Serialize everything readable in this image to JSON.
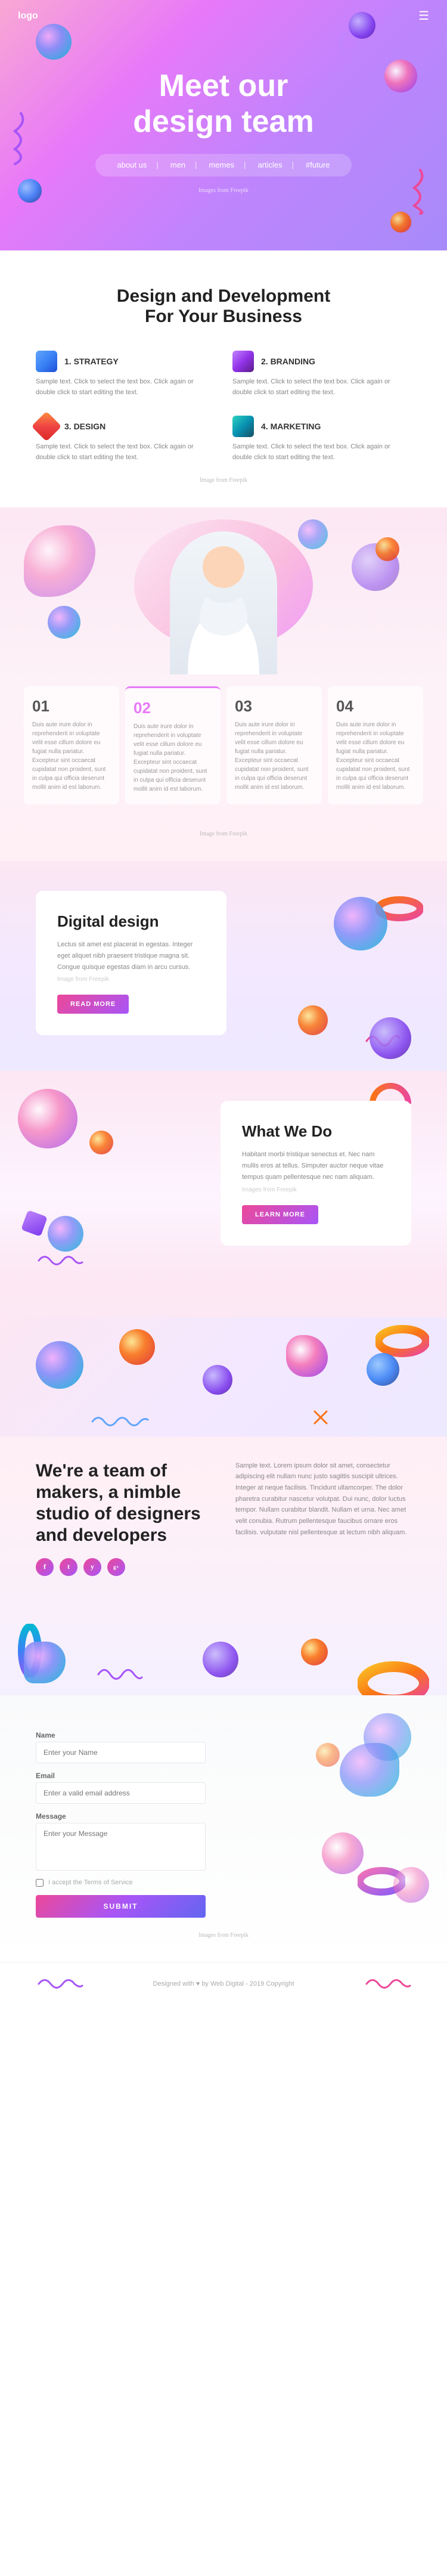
{
  "navbar": {
    "logo": "logo",
    "hamburger": "☰"
  },
  "hero": {
    "title_line1": "Meet our",
    "title_line2": "design team",
    "nav_items": [
      "about us",
      "men",
      "memes",
      "articles",
      "#future"
    ],
    "image_credit": "Images from Freepik"
  },
  "section_design": {
    "title_line1": "Design and Development",
    "title_line2": "For Your Business",
    "cards": [
      {
        "number": "1. STRATEGY",
        "text": "Sample text. Click to select the text box. Click again or double click to start editing the text."
      },
      {
        "number": "2. BRANDING",
        "text": "Sample text. Click to select the text box. Click again or double click to start editing the text."
      },
      {
        "number": "3. DESIGN",
        "text": "Sample text. Click to select the text box. Click again or double click to start editing the text."
      },
      {
        "number": "4. MARKETING",
        "text": "Sample text. Click to select the text box. Click again or double click to start editing the text."
      }
    ],
    "image_credit": "Image from Freepik"
  },
  "section_team": {
    "numbers": [
      {
        "num": "01",
        "text": "Duis aute irure dolor in reprehenderit in voluptate velit esse cillum dolore eu fugiat nulla pariatur. Excepteur sint occaecat cupidatat non proident, sunt in culpa qui officia deserunt mollit anim id est laborum."
      },
      {
        "num": "02",
        "text": "Duis aute irure dolor in reprehenderit in voluptate velit esse cillum dolore eu fugiat nulla pariatur. Excepteur sint occaecat cupidatat non proident, sunt in culpa qui officia deserunt mollit anim id est laborum."
      },
      {
        "num": "03",
        "text": "Duis aute irure dolor in reprehenderit in voluptate velit esse cillum dolore eu fugiat nulla pariatur. Excepteur sint occaecat cupidatat non proident, sunt in culpa qui officia deserunt mollit anim id est laborum."
      },
      {
        "num": "04",
        "text": "Duis aute irure dolor in reprehenderit in voluptate velit esse cillum dolore eu fugiat nulla pariatur. Excepteur sint occaecat cupidatat non proident, sunt in culpa qui officia deserunt mollit anim id est laborum."
      }
    ],
    "image_credit": "Image from Freepik"
  },
  "section_digital": {
    "title": "Digital design",
    "text": "Lectus sit amet est placerat in egestas. Integer eget aliquet nibh praesent tristique magna sit. Congue quisque egestas diam in arcu cursus.",
    "image_credit": "Image from Freepik",
    "button": "READ MORE"
  },
  "section_what": {
    "title": "What We Do",
    "text": "Habitant morbi tristique senectus et. Nec nam mullis eros at tellus. Simputer auctor neque vitae tempus quam pellentesque nec nam aliquam.",
    "image_credit": "Images from Freepik",
    "button": "LEARN MORE"
  },
  "section_makers": {
    "title": "We're a team of makers, a nimble studio of designers and developers",
    "text": "Sample text. Lorem ipsum dolor sit amet, consectetur adipiscing elit nullam nunc justo sagittis suscipit ultrices. Integer at neque facilisis. Tincidunt ullamcorper. The dolor pharetra curabitur nascetur volutpat. Dui nunc, dolor luctus tempor. Nullam curabitur blandit. Nullam et urna. Nec amet velit conubia. Rutrum pellentesque faucibus ornare eros facilisis. vulputate nisl pellentesque at lectum nibh aliquam.",
    "social_icons": [
      "f",
      "t",
      "y",
      "g+"
    ]
  },
  "section_contact": {
    "form": {
      "name_label": "Name",
      "name_placeholder": "Enter your Name",
      "email_label": "Email",
      "email_placeholder": "Enter a valid email address",
      "message_label": "Message",
      "message_placeholder": "Enter your Message",
      "checkbox_text": "I accept the Terms of Service",
      "submit_label": "SUBMIT"
    },
    "image_credit": "Images from Freepik"
  },
  "footer": {
    "text": "Designed with ♥ by Web Digital - 2019 Copyright"
  }
}
